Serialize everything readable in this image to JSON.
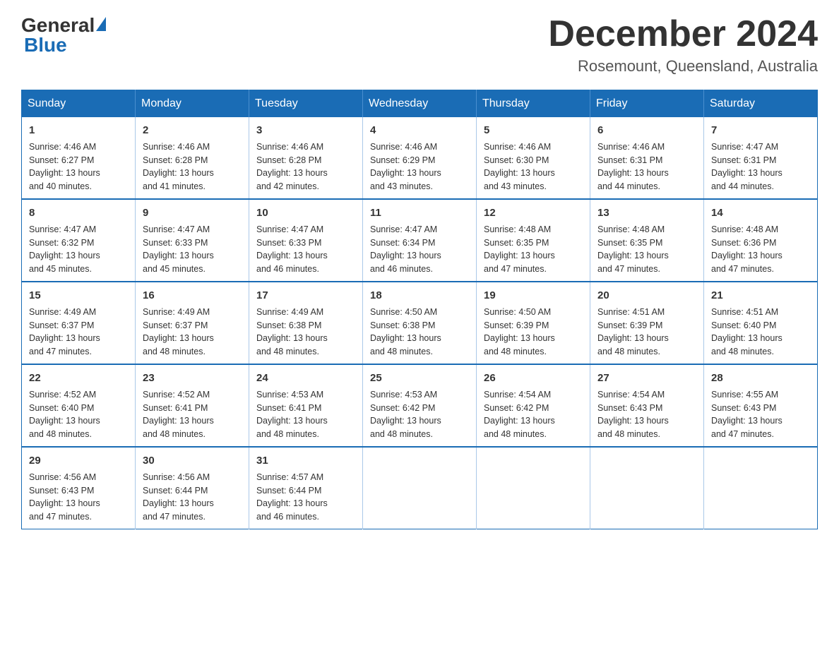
{
  "header": {
    "logo_general": "General",
    "logo_blue": "Blue",
    "month_title": "December 2024",
    "location": "Rosemount, Queensland, Australia"
  },
  "weekdays": [
    "Sunday",
    "Monday",
    "Tuesday",
    "Wednesday",
    "Thursday",
    "Friday",
    "Saturday"
  ],
  "weeks": [
    [
      {
        "day": "1",
        "sunrise": "4:46 AM",
        "sunset": "6:27 PM",
        "daylight": "13 hours and 40 minutes."
      },
      {
        "day": "2",
        "sunrise": "4:46 AM",
        "sunset": "6:28 PM",
        "daylight": "13 hours and 41 minutes."
      },
      {
        "day": "3",
        "sunrise": "4:46 AM",
        "sunset": "6:28 PM",
        "daylight": "13 hours and 42 minutes."
      },
      {
        "day": "4",
        "sunrise": "4:46 AM",
        "sunset": "6:29 PM",
        "daylight": "13 hours and 43 minutes."
      },
      {
        "day": "5",
        "sunrise": "4:46 AM",
        "sunset": "6:30 PM",
        "daylight": "13 hours and 43 minutes."
      },
      {
        "day": "6",
        "sunrise": "4:46 AM",
        "sunset": "6:31 PM",
        "daylight": "13 hours and 44 minutes."
      },
      {
        "day": "7",
        "sunrise": "4:47 AM",
        "sunset": "6:31 PM",
        "daylight": "13 hours and 44 minutes."
      }
    ],
    [
      {
        "day": "8",
        "sunrise": "4:47 AM",
        "sunset": "6:32 PM",
        "daylight": "13 hours and 45 minutes."
      },
      {
        "day": "9",
        "sunrise": "4:47 AM",
        "sunset": "6:33 PM",
        "daylight": "13 hours and 45 minutes."
      },
      {
        "day": "10",
        "sunrise": "4:47 AM",
        "sunset": "6:33 PM",
        "daylight": "13 hours and 46 minutes."
      },
      {
        "day": "11",
        "sunrise": "4:47 AM",
        "sunset": "6:34 PM",
        "daylight": "13 hours and 46 minutes."
      },
      {
        "day": "12",
        "sunrise": "4:48 AM",
        "sunset": "6:35 PM",
        "daylight": "13 hours and 47 minutes."
      },
      {
        "day": "13",
        "sunrise": "4:48 AM",
        "sunset": "6:35 PM",
        "daylight": "13 hours and 47 minutes."
      },
      {
        "day": "14",
        "sunrise": "4:48 AM",
        "sunset": "6:36 PM",
        "daylight": "13 hours and 47 minutes."
      }
    ],
    [
      {
        "day": "15",
        "sunrise": "4:49 AM",
        "sunset": "6:37 PM",
        "daylight": "13 hours and 47 minutes."
      },
      {
        "day": "16",
        "sunrise": "4:49 AM",
        "sunset": "6:37 PM",
        "daylight": "13 hours and 48 minutes."
      },
      {
        "day": "17",
        "sunrise": "4:49 AM",
        "sunset": "6:38 PM",
        "daylight": "13 hours and 48 minutes."
      },
      {
        "day": "18",
        "sunrise": "4:50 AM",
        "sunset": "6:38 PM",
        "daylight": "13 hours and 48 minutes."
      },
      {
        "day": "19",
        "sunrise": "4:50 AM",
        "sunset": "6:39 PM",
        "daylight": "13 hours and 48 minutes."
      },
      {
        "day": "20",
        "sunrise": "4:51 AM",
        "sunset": "6:39 PM",
        "daylight": "13 hours and 48 minutes."
      },
      {
        "day": "21",
        "sunrise": "4:51 AM",
        "sunset": "6:40 PM",
        "daylight": "13 hours and 48 minutes."
      }
    ],
    [
      {
        "day": "22",
        "sunrise": "4:52 AM",
        "sunset": "6:40 PM",
        "daylight": "13 hours and 48 minutes."
      },
      {
        "day": "23",
        "sunrise": "4:52 AM",
        "sunset": "6:41 PM",
        "daylight": "13 hours and 48 minutes."
      },
      {
        "day": "24",
        "sunrise": "4:53 AM",
        "sunset": "6:41 PM",
        "daylight": "13 hours and 48 minutes."
      },
      {
        "day": "25",
        "sunrise": "4:53 AM",
        "sunset": "6:42 PM",
        "daylight": "13 hours and 48 minutes."
      },
      {
        "day": "26",
        "sunrise": "4:54 AM",
        "sunset": "6:42 PM",
        "daylight": "13 hours and 48 minutes."
      },
      {
        "day": "27",
        "sunrise": "4:54 AM",
        "sunset": "6:43 PM",
        "daylight": "13 hours and 48 minutes."
      },
      {
        "day": "28",
        "sunrise": "4:55 AM",
        "sunset": "6:43 PM",
        "daylight": "13 hours and 47 minutes."
      }
    ],
    [
      {
        "day": "29",
        "sunrise": "4:56 AM",
        "sunset": "6:43 PM",
        "daylight": "13 hours and 47 minutes."
      },
      {
        "day": "30",
        "sunrise": "4:56 AM",
        "sunset": "6:44 PM",
        "daylight": "13 hours and 47 minutes."
      },
      {
        "day": "31",
        "sunrise": "4:57 AM",
        "sunset": "6:44 PM",
        "daylight": "13 hours and 46 minutes."
      },
      null,
      null,
      null,
      null
    ]
  ],
  "labels": {
    "sunrise": "Sunrise:",
    "sunset": "Sunset:",
    "daylight": "Daylight:"
  }
}
